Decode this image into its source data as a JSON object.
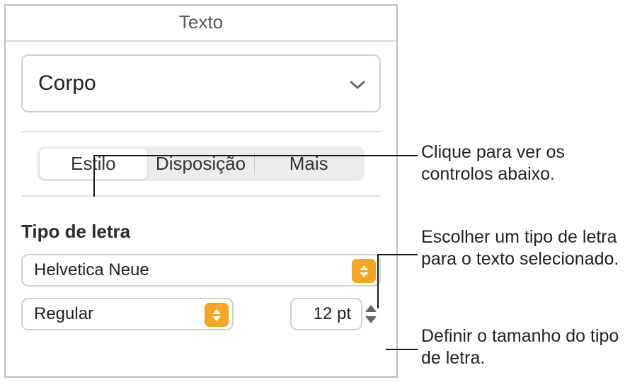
{
  "panel": {
    "title": "Texto",
    "paragraph_style": "Corpo",
    "tabs": {
      "style": "Estilo",
      "layout": "Disposição",
      "more": "Mais"
    },
    "font_section_label": "Tipo de letra",
    "font_family": "Helvetica Neue",
    "font_weight": "Regular",
    "font_size": "12 pt"
  },
  "callouts": {
    "c1": "Clique para ver os controlos abaixo.",
    "c2": "Escolher um tipo de letra para o texto selecionado.",
    "c3": "Definir o tamanho do tipo de letra."
  }
}
